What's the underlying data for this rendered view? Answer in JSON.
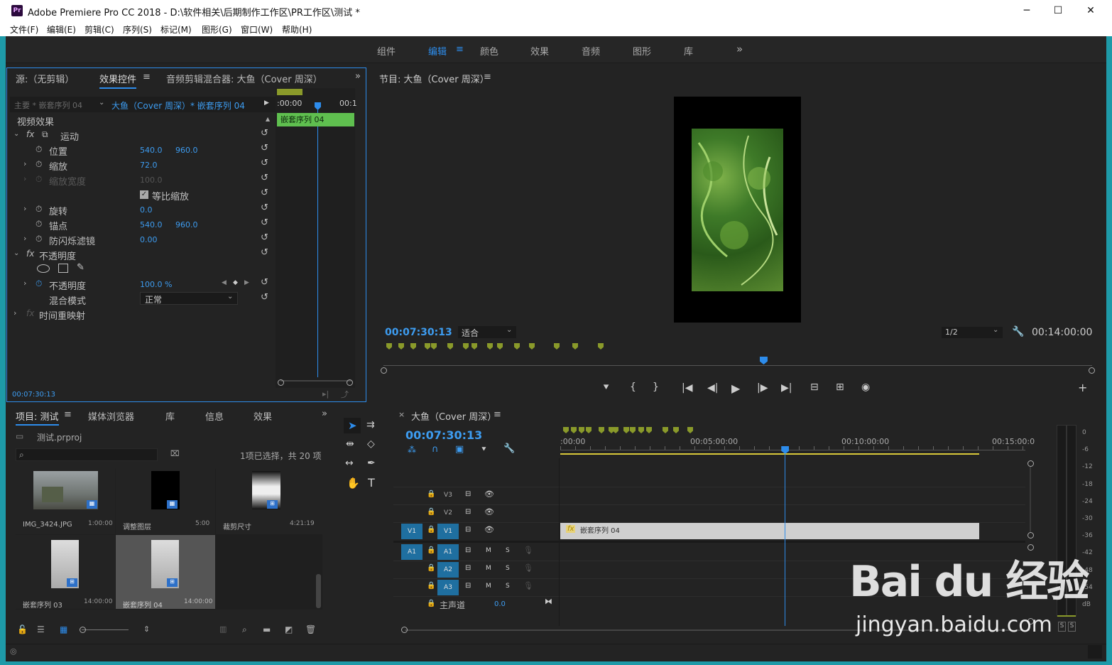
{
  "window": {
    "title": "Adobe Premiere Pro CC 2018 - D:\\软件相关\\后期制作工作区\\PR工作区\\测试 *",
    "logo": "Pr"
  },
  "menu": [
    "文件(F)",
    "编辑(E)",
    "剪辑(C)",
    "序列(S)",
    "标记(M)",
    "图形(G)",
    "窗口(W)",
    "帮助(H)"
  ],
  "workspaces": [
    "组件",
    "编辑",
    "颜色",
    "效果",
    "音频",
    "图形",
    "库"
  ],
  "effect_panel": {
    "tabs": [
      "源:（无剪辑）",
      "效果控件",
      "音频剪辑混合器: 大鱼（Cover 周深）"
    ],
    "master": "主要 * 嵌套序列 04",
    "clip": "大鱼（Cover 周深）* 嵌套序列 04",
    "timecode_start": ":00:00",
    "timecode_end": "00:1",
    "clip_bar": "嵌套序列 04",
    "video_effects": "视频效果",
    "motion": "运动",
    "position": "位置",
    "position_x": "540.0",
    "position_y": "960.0",
    "scale": "缩放",
    "scale_val": "72.0",
    "scale_width": "缩放宽度",
    "scale_width_val": "100.0",
    "uniform_scale": "等比缩放",
    "rotation": "旋转",
    "rotation_val": "0.0",
    "anchor": "锚点",
    "anchor_x": "540.0",
    "anchor_y": "960.0",
    "antiflicker": "防闪烁滤镜",
    "antiflicker_val": "0.00",
    "opacity_group": "不透明度",
    "opacity": "不透明度",
    "opacity_val": "100.0 %",
    "blend_mode": "混合模式",
    "blend_val": "正常",
    "time_remap": "时间重映射",
    "footer_tc": "00:07:30:13"
  },
  "program": {
    "title": "节目: 大鱼（Cover 周深）",
    "timecode": "00:07:30:13",
    "fit": "适合",
    "resolution": "1/2",
    "duration": "00:14:00:00",
    "playhead_fraction": 0.536
  },
  "project": {
    "tabs": [
      "项目: 测试",
      "媒体浏览器",
      "库",
      "信息",
      "效果"
    ],
    "file": "测试.prproj",
    "status": "1项已选择，共 20 项",
    "items": [
      {
        "name": "IMG_3424.JPG",
        "dur": "1:00:00"
      },
      {
        "name": "调整图层",
        "dur": "5:00"
      },
      {
        "name": "裁剪尺寸",
        "dur": "4:21:19"
      },
      {
        "name": "嵌套序列 03",
        "dur": "14:00:00"
      },
      {
        "name": "嵌套序列 04",
        "dur": "14:00:00"
      }
    ]
  },
  "timeline": {
    "title": "大鱼（Cover 周深）",
    "timecode": "00:07:30:13",
    "ruler": [
      ":00:00",
      "00:05:00:00",
      "00:10:00:00",
      "00:15:00:0"
    ],
    "tracks_video": [
      "V3",
      "V2",
      "V1"
    ],
    "tracks_audio": [
      "A1",
      "A2",
      "A3"
    ],
    "src_v": "V1",
    "src_a": "A1",
    "mute": "M",
    "solo": "S",
    "master": "主声道",
    "master_val": "0.0",
    "clip": "嵌套序列 04",
    "fx": "fx",
    "playhead_fraction": 0.536
  },
  "meter": {
    "ticks": [
      "0",
      "-6",
      "-12",
      "-18",
      "-24",
      "-30",
      "-36",
      "-42",
      "-48",
      "-54",
      "dB"
    ],
    "solo": "S"
  },
  "colors": {
    "accent": "#2d8ceb",
    "clip_green": "#5fbf4f",
    "marker": "#8a9a2a",
    "timeline_clip": "#cfcfcf"
  },
  "watermark": {
    "logo": "Bai du 经验",
    "url": "jingyan.baidu.com"
  }
}
